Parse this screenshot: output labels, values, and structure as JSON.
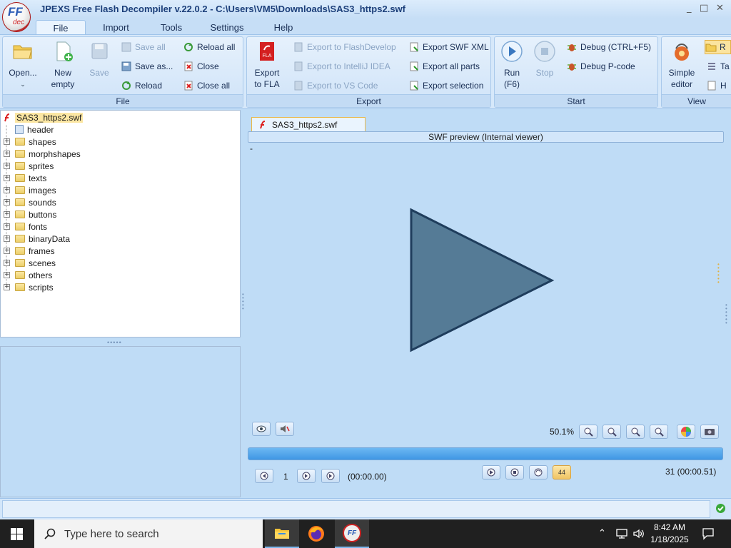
{
  "window": {
    "title": "JPEXS Free Flash Decompiler v.22.0.2 - C:\\Users\\VM5\\Downloads\\SAS3_https2.swf",
    "logo_text": "FF",
    "logo_sub": "dec",
    "controls": [
      "_",
      "□",
      "✕"
    ]
  },
  "menu_tabs": [
    {
      "label": "File",
      "active": true
    },
    {
      "label": "Import"
    },
    {
      "label": "Tools"
    },
    {
      "label": "Settings"
    },
    {
      "label": "Help"
    }
  ],
  "ribbon": {
    "file": {
      "label": "File",
      "open": "Open...",
      "new_line1": "New",
      "new_line2": "empty",
      "save": "Save",
      "save_all": "Save all",
      "save_as": "Save as...",
      "reload": "Reload",
      "reload_all": "Reload all",
      "close": "Close",
      "close_all": "Close all"
    },
    "export": {
      "label": "Export",
      "fla_line1": "Export",
      "fla_line2": "to FLA",
      "flashdevelop": "Export to FlashDevelop",
      "intellij": "Export to IntelliJ IDEA",
      "vscode": "Export to VS Code",
      "swf_xml": "Export SWF XML",
      "all_parts": "Export all parts",
      "selection": "Export selection"
    },
    "start": {
      "label": "Start",
      "run_line1": "Run",
      "run_line2": "(F6)",
      "stop": "Stop",
      "debug": "Debug (CTRL+F5)",
      "debug_pcode": "Debug P-code"
    },
    "view": {
      "label": "View",
      "simple_line1": "Simple",
      "simple_line2": "editor",
      "r_label": "R",
      "t_label": "Ta",
      "h_label": "H"
    }
  },
  "tree": {
    "root": "SAS3_https2.swf",
    "items": [
      {
        "label": "header",
        "expandable": false
      },
      {
        "label": "shapes",
        "expandable": true
      },
      {
        "label": "morphshapes",
        "expandable": true
      },
      {
        "label": "sprites",
        "expandable": true
      },
      {
        "label": "texts",
        "expandable": true
      },
      {
        "label": "images",
        "expandable": true
      },
      {
        "label": "sounds",
        "expandable": true
      },
      {
        "label": "buttons",
        "expandable": true
      },
      {
        "label": "fonts",
        "expandable": true
      },
      {
        "label": "binaryData",
        "expandable": true
      },
      {
        "label": "frames",
        "expandable": true
      },
      {
        "label": "scenes",
        "expandable": true
      },
      {
        "label": "others",
        "expandable": true
      },
      {
        "label": "scripts",
        "expandable": true
      }
    ]
  },
  "document_tab": "SAS3_https2.swf",
  "preview": {
    "header": "SWF preview (Internal viewer)",
    "dash": "-",
    "zoom": "50.1%",
    "frame_current": "1",
    "time_current": "(00:00.00)",
    "frame_total": "31 (00:00.51)",
    "fps_badge": "44",
    "progress_fraction": 1.0,
    "play_triangle_color": "#557b96"
  },
  "taskbar": {
    "search_placeholder": "Type here to search",
    "time": "8:42 AM",
    "date": "1/18/2025"
  }
}
